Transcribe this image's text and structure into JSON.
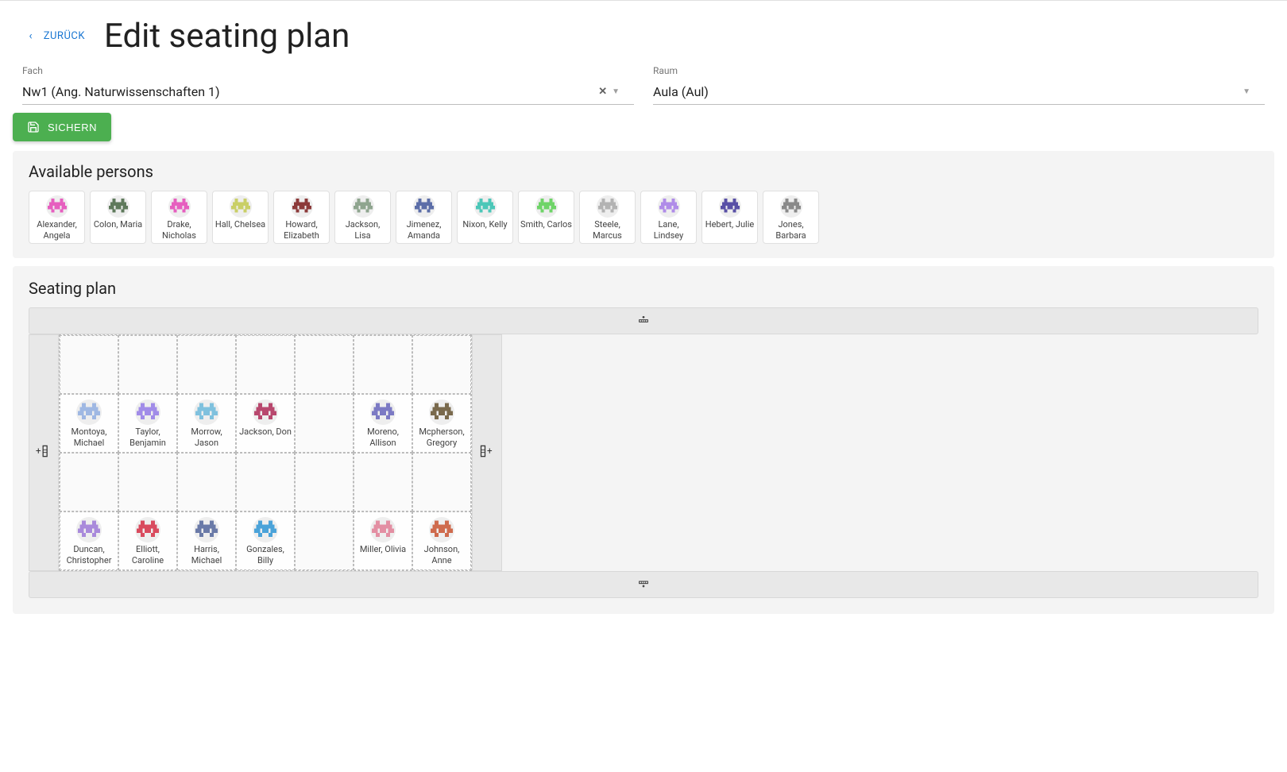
{
  "header": {
    "back_label": "ZURÜCK",
    "title": "Edit seating plan"
  },
  "fields": {
    "subject_label": "Fach",
    "subject_value": "Nw1 (Ang. Naturwissenschaften 1)",
    "room_label": "Raum",
    "room_value": "Aula (Aul)"
  },
  "actions": {
    "save_label": "SICHERN"
  },
  "available": {
    "title": "Available persons",
    "persons": [
      {
        "name": "Alexander, Angela",
        "color": "#e65fbf"
      },
      {
        "name": "Colon, Maria",
        "color": "#5f7a5c"
      },
      {
        "name": "Drake, Nicholas",
        "color": "#e65fbf"
      },
      {
        "name": "Hall, Chelsea",
        "color": "#c9cf67"
      },
      {
        "name": "Howard, Elizabeth",
        "color": "#8c3a3a"
      },
      {
        "name": "Jackson, Lisa",
        "color": "#8fa58f"
      },
      {
        "name": "Jimenez, Amanda",
        "color": "#5c6ea8"
      },
      {
        "name": "Nixon, Kelly",
        "color": "#4cc7b8"
      },
      {
        "name": "Smith, Carlos",
        "color": "#6fd468"
      },
      {
        "name": "Steele, Marcus",
        "color": "#b3b3b3"
      },
      {
        "name": "Lane, Lindsey",
        "color": "#b08ce8"
      },
      {
        "name": "Hebert, Julie",
        "color": "#5950a6"
      },
      {
        "name": "Jones, Barbara",
        "color": "#8a8a8a"
      }
    ]
  },
  "seating": {
    "title": "Seating plan",
    "cells": [
      [
        null,
        null,
        null,
        null,
        null,
        null,
        null
      ],
      [
        {
          "name": "Montoya, Michael",
          "color": "#9fb8e3"
        },
        {
          "name": "Taylor, Benjamin",
          "color": "#a18ce8"
        },
        {
          "name": "Morrow, Jason",
          "color": "#7fc1de"
        },
        {
          "name": "Jackson, Don",
          "color": "#b8486e"
        },
        null,
        {
          "name": "Moreno, Allison",
          "color": "#7c7ac4"
        },
        {
          "name": "Mcpherson, Gregory",
          "color": "#7a6a4d"
        }
      ],
      [
        null,
        null,
        null,
        null,
        null,
        null,
        null
      ],
      [
        {
          "name": "Duncan, Christopher",
          "color": "#a98adb"
        },
        {
          "name": "Elliott, Caroline",
          "color": "#d94b5e"
        },
        {
          "name": "Harris, Michael",
          "color": "#6a7aa8"
        },
        {
          "name": "Gonzales, Billy",
          "color": "#4ba3d9"
        },
        null,
        {
          "name": "Miller, Olivia",
          "color": "#e38fa3"
        },
        {
          "name": "Johnson, Anne",
          "color": "#cf6b4d"
        }
      ]
    ]
  }
}
